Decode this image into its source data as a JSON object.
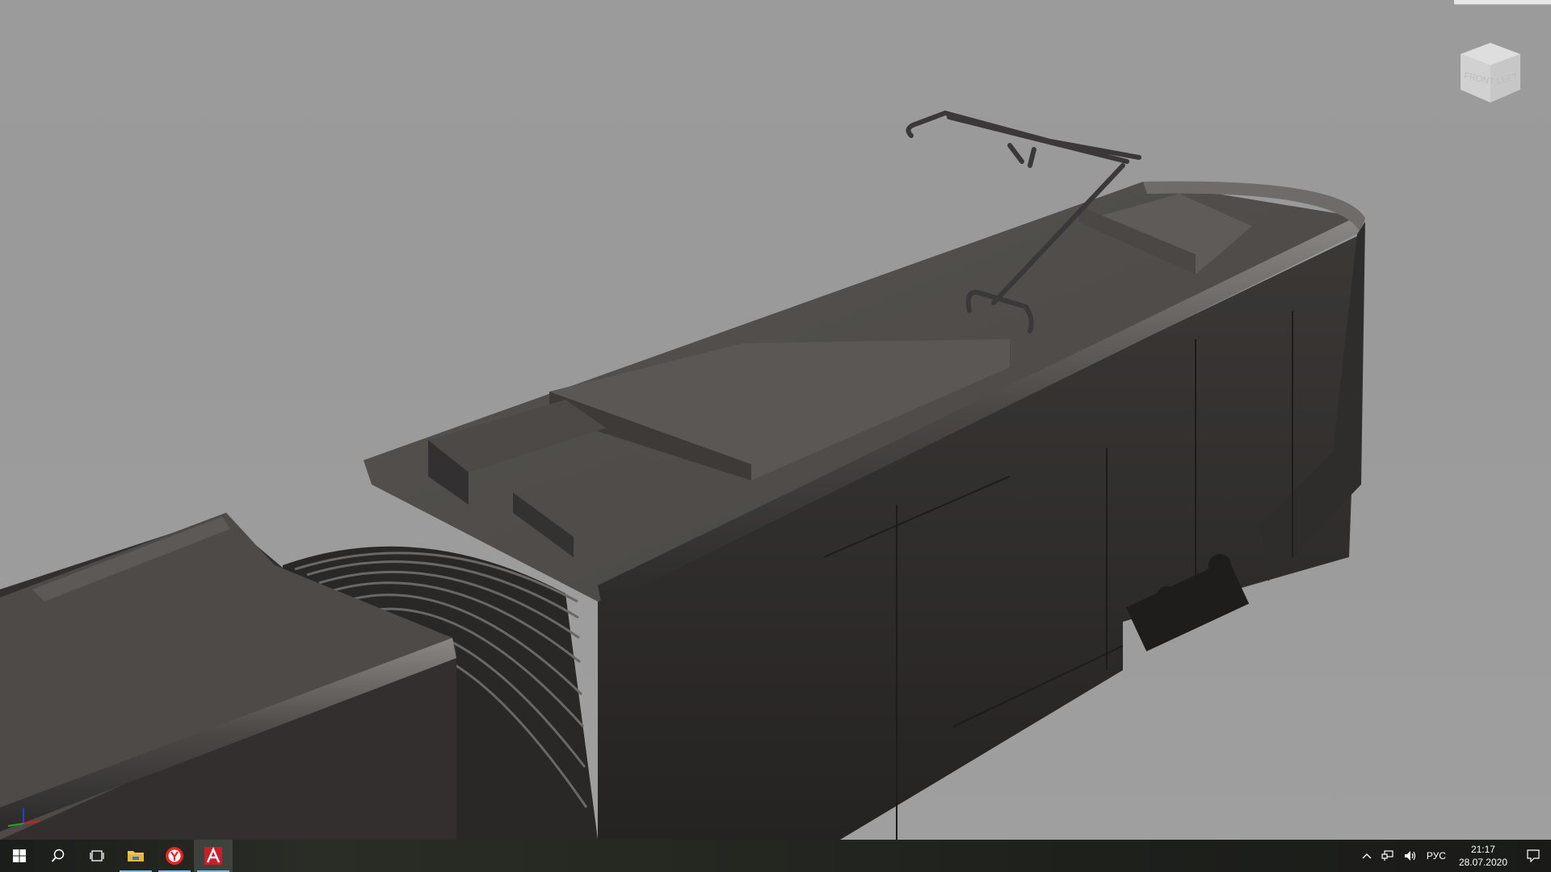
{
  "app": {
    "viewport_background": "#9b9b9b",
    "model_color": "#3a3735"
  },
  "viewcube": {
    "face_front": "FRONT",
    "face_left": "LEFT"
  },
  "taskbar": {
    "items": [
      {
        "name": "start",
        "icon": "windows-logo-icon"
      },
      {
        "name": "search",
        "icon": "search-icon"
      },
      {
        "name": "task-view",
        "icon": "task-view-icon"
      },
      {
        "name": "file-explorer",
        "icon": "folder-icon"
      },
      {
        "name": "yandex-browser",
        "icon": "yandex-browser-icon"
      },
      {
        "name": "autodesk-app",
        "icon": "autodesk-a-icon"
      }
    ],
    "tray": {
      "language": "РУС",
      "time": "21:17",
      "date": "28.07.2020"
    },
    "accent": "#76b9ed"
  }
}
